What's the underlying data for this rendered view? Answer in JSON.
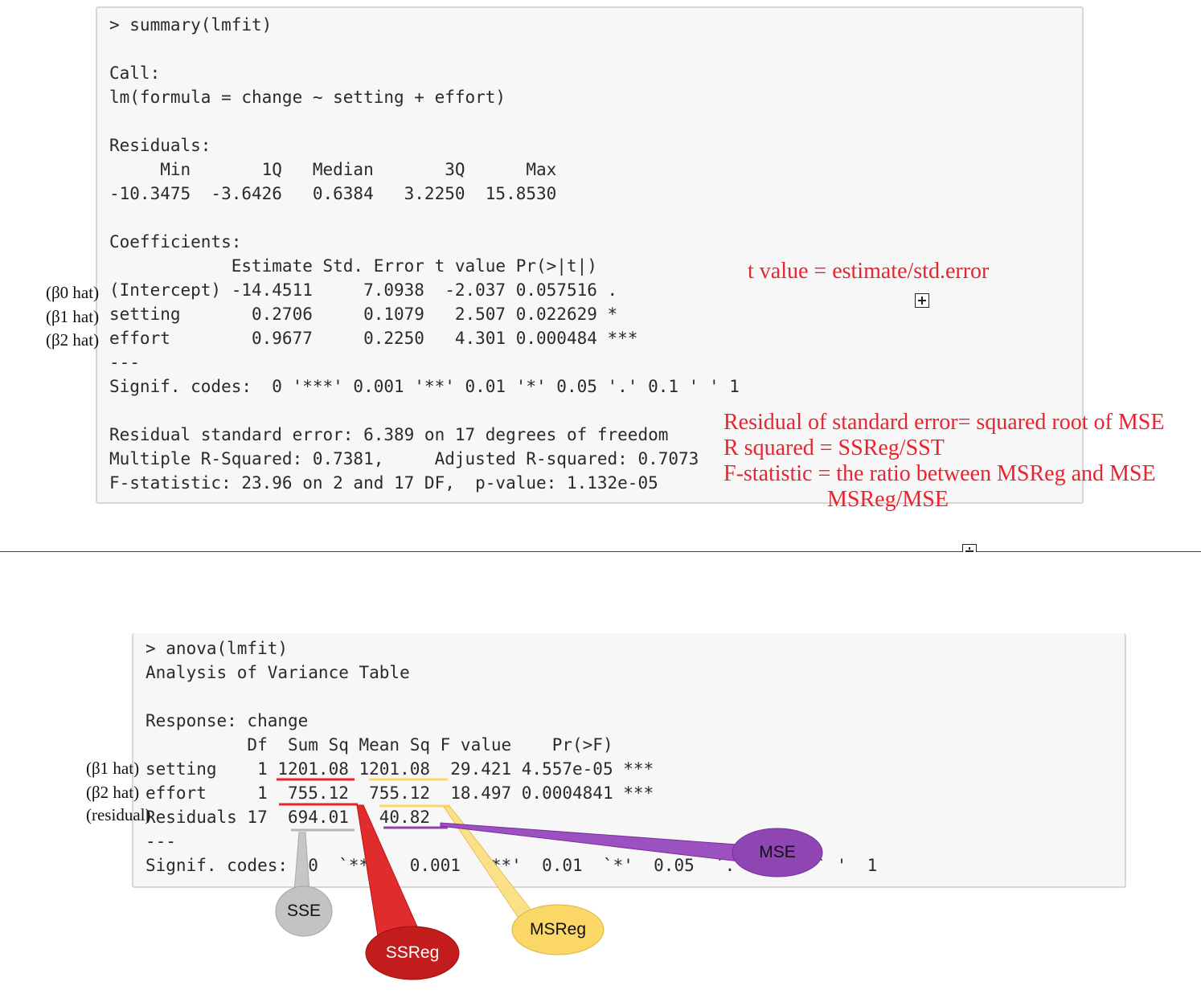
{
  "summary": {
    "lines": [
      "> summary(lmfit)",
      "",
      "Call:",
      "lm(formula = change ~ setting + effort)",
      "",
      "Residuals:",
      "     Min       1Q   Median       3Q      Max ",
      "-10.3475  -3.6426   0.6384   3.2250  15.8530 ",
      "",
      "Coefficients:",
      "            Estimate Std. Error t value Pr(>|t|)    ",
      "(Intercept) -14.4511     7.0938  -2.037 0.057516 .  ",
      "setting       0.2706     0.1079   2.507 0.022629 *  ",
      "effort        0.9677     0.2250   4.301 0.000484 ***",
      "---",
      "Signif. codes:  0 '***' 0.001 '**' 0.01 '*' 0.05 '.' 0.1 ' ' 1 ",
      "",
      "Residual standard error: 6.389 on 17 degrees of freedom",
      "Multiple R-Squared: 0.7381,     Adjusted R-squared: 0.7073 ",
      "F-statistic: 23.96 on 2 and 17 DF,  p-value: 1.132e-05 "
    ],
    "beta_labels": [
      "(β0 hat)",
      "(β1 hat)",
      "(β2 hat)"
    ]
  },
  "notes": {
    "t_value": "t value = estimate/std.error",
    "residual_se": "Residual of standard error= squared root of MSE",
    "r_squared": "R squared =  SSReg/SST",
    "f_statistic": "F-statistic = the ratio between MSReg and MSE",
    "ms_ratio": "MSReg/MSE"
  },
  "anova": {
    "lines": [
      "> anova(lmfit)",
      "Analysis of Variance Table",
      "",
      "Response: change",
      "          Df  Sum Sq Mean Sq F value    Pr(>F)    ",
      "setting    1 1201.08 1201.08  29.421 4.557e-05 ***",
      "effort     1  755.12  755.12  18.497 0.0004841 ***",
      "Residuals 17  694.01   40.82                      ",
      "---",
      "Signif. codes:  0  `***'  0.001  `**'  0.01  `*'  0.05  `.'  0.1  ` '  1"
    ],
    "beta_labels": [
      "(β1 hat)",
      "(β2 hat)",
      "(residual)"
    ]
  },
  "callouts": {
    "sse": "SSE",
    "ssreg": "SSReg",
    "msreg": "MSReg",
    "mse": "MSE"
  },
  "colors": {
    "note_red": "#e8242f",
    "sse_gray": "#bdbdbd",
    "ssreg_red": "#c41b1b",
    "msreg_yellow": "#fad766",
    "mse_purple": "#8e44ad"
  }
}
